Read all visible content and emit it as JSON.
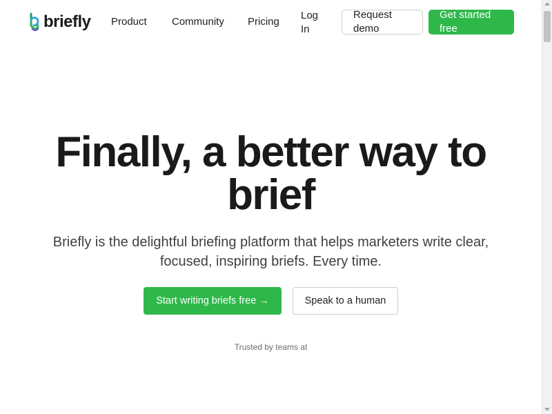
{
  "brand": {
    "name": "briefly",
    "logo_icon": "briefly-logo-icon",
    "accent_color": "#2fb84a"
  },
  "nav": {
    "items": [
      {
        "label": "Product"
      },
      {
        "label": "Community"
      },
      {
        "label": "Pricing"
      },
      {
        "label": "Log In"
      }
    ],
    "request_demo_label": "Request demo",
    "get_started_label": "Get started free"
  },
  "hero": {
    "title": "Finally, a better way to brief",
    "subtitle": "Briefly is the delightful briefing platform that helps marketers write clear, focused, inspiring briefs. Every time.",
    "primary_cta": "Start writing briefs free →",
    "secondary_cta": "Speak to a human",
    "trusted_text": "Trusted by teams at"
  }
}
